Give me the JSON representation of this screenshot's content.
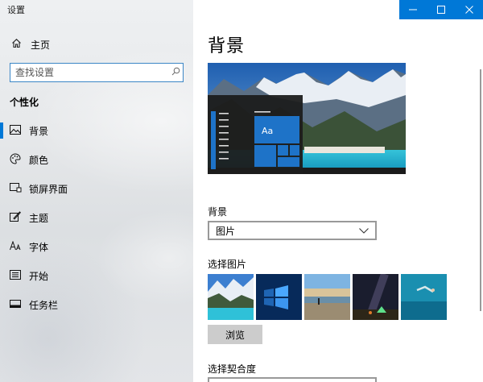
{
  "window": {
    "title": "设置"
  },
  "sidebar": {
    "home_label": "主页",
    "search_placeholder": "查找设置",
    "section_heading": "个性化",
    "items": [
      {
        "label": "背景",
        "icon": "picture-icon",
        "active": true
      },
      {
        "label": "颜色",
        "icon": "palette-icon",
        "active": false
      },
      {
        "label": "锁屏界面",
        "icon": "lock-screen-icon",
        "active": false
      },
      {
        "label": "主题",
        "icon": "theme-icon",
        "active": false
      },
      {
        "label": "字体",
        "icon": "font-icon",
        "active": false
      },
      {
        "label": "开始",
        "icon": "start-icon",
        "active": false
      },
      {
        "label": "任务栏",
        "icon": "taskbar-icon",
        "active": false
      }
    ]
  },
  "main": {
    "title": "背景",
    "preview": {
      "tile_text": "Aa"
    },
    "background_label": "背景",
    "background_value": "图片",
    "choose_picture_label": "选择图片",
    "thumbnails": [
      {
        "icon": "mountain-lake-thumbnail"
      },
      {
        "icon": "windows-logo-thumbnail"
      },
      {
        "icon": "beach-person-thumbnail"
      },
      {
        "icon": "night-sky-tent-thumbnail"
      },
      {
        "icon": "underwater-swimmer-thumbnail"
      }
    ],
    "browse_label": "浏览",
    "fit_label": "选择契合度"
  },
  "colors": {
    "accent": "#0078d7",
    "tile": "#1e73c8"
  }
}
